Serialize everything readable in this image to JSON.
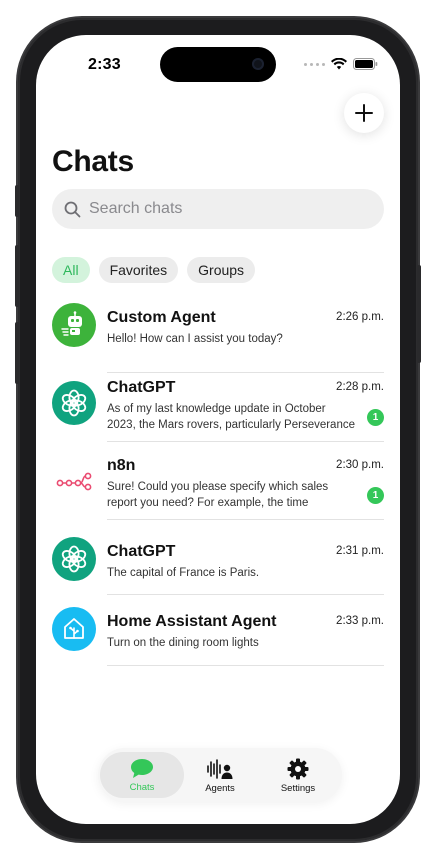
{
  "status_bar": {
    "time": "2:33"
  },
  "header": {
    "title": "Chats"
  },
  "search": {
    "placeholder": "Search chats"
  },
  "filters": [
    "All",
    "Favorites",
    "Groups"
  ],
  "chats": [
    {
      "name": "Custom Agent",
      "time": "2:26 p.m.",
      "preview": "Hello! How can I assist you today?",
      "unread": null,
      "avatar_icon": "robot-icon",
      "avatar_color": "#3db33b"
    },
    {
      "name": "ChatGPT",
      "time": "2:28 p.m.",
      "preview": "As of my last knowledge update in October 2023, the Mars rovers, particularly Perseverance and…",
      "unread": "1",
      "avatar_icon": "openai-icon",
      "avatar_color": "#10a37f"
    },
    {
      "name": "n8n",
      "time": "2:30 p.m.",
      "preview": "Sure! Could you please specify which sales report you need? For example, the time period,…",
      "unread": "1",
      "avatar_icon": "n8n-icon",
      "avatar_color": "#ea4b71"
    },
    {
      "name": "ChatGPT",
      "time": "2:31 p.m.",
      "preview": "The capital of France is Paris.",
      "unread": null,
      "avatar_icon": "openai-icon",
      "avatar_color": "#10a37f"
    },
    {
      "name": "Home Assistant Agent",
      "time": "2:33 p.m.",
      "preview": "Turn on the dining room lights",
      "unread": null,
      "avatar_icon": "home-assistant-icon",
      "avatar_color": "#18bcf2"
    }
  ],
  "tabbar": {
    "items": [
      {
        "label": "Chats",
        "icon": "chat-bubble-icon",
        "active": true
      },
      {
        "label": "Agents",
        "icon": "agents-icon",
        "active": false
      },
      {
        "label": "Settings",
        "icon": "gear-icon",
        "active": false
      }
    ]
  },
  "colors": {
    "accent": "#34c759",
    "chip_active_bg": "#d3f3dc"
  }
}
